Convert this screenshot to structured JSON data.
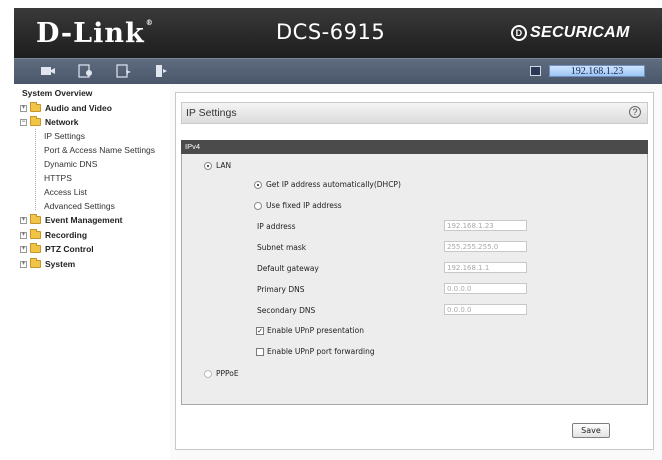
{
  "header": {
    "brand": "D-Link",
    "model": "DCS-6915",
    "product_line": "SECURICAM",
    "background": "#2b2b2b"
  },
  "toolbar": {
    "icons": [
      "live-video-icon",
      "playback-icon",
      "setup-icon",
      "logout-icon"
    ],
    "ip_address": "192.168.1.23"
  },
  "sidebar": {
    "title": "System Overview",
    "items": [
      {
        "label": "Audio and Video",
        "level": 0,
        "expanded": false
      },
      {
        "label": "Network",
        "level": 0,
        "expanded": true
      },
      {
        "label": "IP Settings",
        "level": 1
      },
      {
        "label": "Port & Access Name Settings",
        "level": 1
      },
      {
        "label": "Dynamic DNS",
        "level": 1
      },
      {
        "label": "HTTPS",
        "level": 1
      },
      {
        "label": "Access List",
        "level": 1
      },
      {
        "label": "Advanced Settings",
        "level": 1
      },
      {
        "label": "Event Management",
        "level": 0,
        "expanded": false
      },
      {
        "label": "Recording",
        "level": 0,
        "expanded": false
      },
      {
        "label": "PTZ Control",
        "level": 0,
        "expanded": false
      },
      {
        "label": "System",
        "level": 0,
        "expanded": false
      }
    ]
  },
  "main": {
    "title": "IP Settings",
    "help": "?",
    "section": "IPv4",
    "lan_label": "LAN",
    "dhcp_label": "Get IP address automatically(DHCP)",
    "fixed_label": "Use fixed IP address",
    "fields": [
      {
        "label": "IP address",
        "value": "192.168.1.23"
      },
      {
        "label": "Subnet mask",
        "value": "255.255.255.0"
      },
      {
        "label": "Default gateway",
        "value": "192.168.1.1"
      },
      {
        "label": "Primary DNS",
        "value": "0.0.0.0"
      },
      {
        "label": "Secondary DNS",
        "value": "0.0.0.0"
      }
    ],
    "upnp_presentation_label": "Enable UPnP presentation",
    "upnp_presentation_checked": true,
    "upnp_port_label": "Enable UPnP port forwarding",
    "upnp_port_checked": false,
    "pppoe_label": "PPPoE",
    "save_label": "Save",
    "connection": "LAN",
    "ip_mode": "DHCP"
  }
}
